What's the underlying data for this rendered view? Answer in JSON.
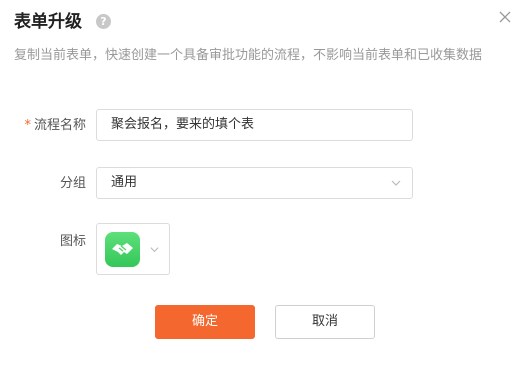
{
  "dialog": {
    "title": "表单升级",
    "help_icon": "question-circle-icon",
    "help_glyph": "?",
    "close_icon": "close-icon",
    "description": "复制当前表单，快速创建一个具备审批功能的流程，不影响当前表单和已收集数据"
  },
  "form": {
    "name": {
      "required_mark": "*",
      "label": "流程名称",
      "value": "聚会报名，要来的填个表"
    },
    "group": {
      "label": "分组",
      "value": "通用",
      "chevron_icon": "chevron-down-icon"
    },
    "icon": {
      "label": "图标",
      "selected_icon": "handshake-icon",
      "icon_color": "#4cd964",
      "chevron_icon": "chevron-down-icon"
    }
  },
  "actions": {
    "confirm_label": "确定",
    "cancel_label": "取消"
  },
  "colors": {
    "accent": "#f4672f",
    "required": "#f4672f",
    "icon_bg": "#4cd964"
  }
}
